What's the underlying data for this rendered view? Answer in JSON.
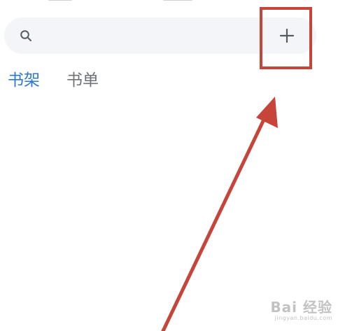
{
  "tabs": [
    {
      "label": "书架",
      "active": true
    },
    {
      "label": "书单",
      "active": false
    }
  ],
  "icons": {
    "search": "search-icon",
    "add": "plus-icon"
  },
  "colors": {
    "active_tab": "#2b78cf",
    "inactive_tab": "#6f7276",
    "search_bg": "#f4f5f8",
    "annotation": "#c7443b",
    "icon": "#555b63"
  },
  "watermark": {
    "main": "Bai 经验",
    "sub": "jingyan.baidu.com"
  }
}
